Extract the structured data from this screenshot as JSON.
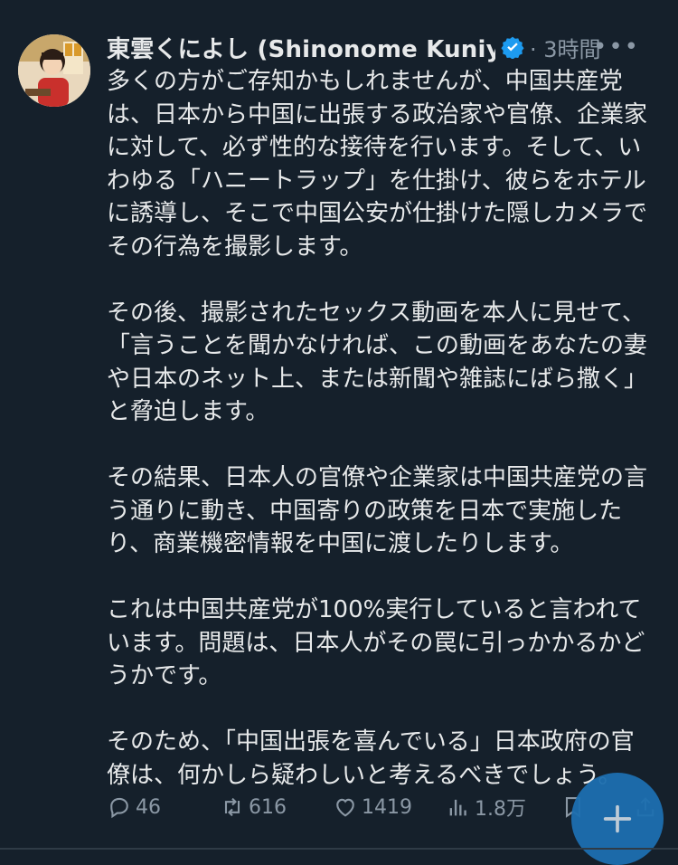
{
  "author": {
    "name": "東雲くによし (Shinonome Kuniy...",
    "time": "3時間"
  },
  "body": {
    "p1": [
      "多くの方がご存知かもしれませんが、中国共産党",
      "は、日本から中国に出張する政治家や官僚、企業家",
      "に対して、必ず性的な接待を行います。そして、い",
      "わゆる「ハニートラップ」を仕掛け、彼らをホテル",
      "に誘導し、そこで中国公安が仕掛けた隠しカメラで",
      "その行為を撮影します。"
    ],
    "p2": [
      "その後、撮影されたセックス動画を本人に見せて、",
      "「言うことを聞かなければ、この動画をあなたの妻",
      "や日本のネット上、または新聞や雑誌にばら撒く」",
      "と脅迫します。"
    ],
    "p3": [
      "その結果、日本人の官僚や企業家は中国共産党の言",
      "う通りに動き、中国寄りの政策を日本で実施した",
      "り、商業機密情報を中国に渡したりします。"
    ],
    "p4": [
      "これは中国共産党が100%実行していると言われて",
      "います。問題は、日本人がその罠に引っかかるかど",
      "うかです。"
    ],
    "p5": [
      "そのため、「中国出張を喜んでいる」日本政府の官",
      "僚は、何かしら疑わしいと考えるべきでしょう。"
    ]
  },
  "actions": {
    "replies": "46",
    "retweets": "616",
    "likes": "1419",
    "views": "1.8万"
  },
  "colors": {
    "background": "#15202b",
    "text": "#e7e9ea",
    "muted": "#8b98a5",
    "verified": "#1d9bf0",
    "fab": "#1d6fb0"
  },
  "icons": [
    "avatar-illustration",
    "verified-badge-icon",
    "more-icon",
    "reply-icon",
    "retweet-icon",
    "like-icon",
    "views-icon",
    "bookmark-icon",
    "share-icon",
    "compose-plus-icon"
  ]
}
